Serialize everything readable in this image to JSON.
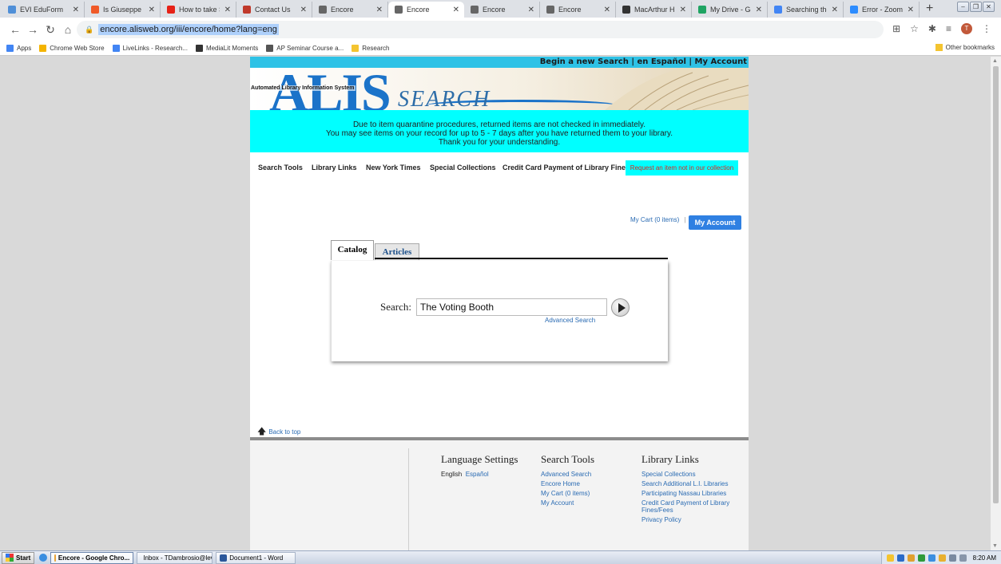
{
  "browser": {
    "tabs": [
      {
        "label": "EVI EduForm",
        "color": "#4f8fd8",
        "active": false
      },
      {
        "label": "Is Giuseppe Cor",
        "color": "#f05a28",
        "active": false
      },
      {
        "label": "How to take Scr",
        "color": "#e62117",
        "active": false
      },
      {
        "label": "Contact Us",
        "color": "#c0392b",
        "active": false
      },
      {
        "label": "Encore",
        "color": "#666666",
        "active": false
      },
      {
        "label": "Encore",
        "color": "#666666",
        "active": true
      },
      {
        "label": "Encore",
        "color": "#666666",
        "active": false
      },
      {
        "label": "Encore",
        "color": "#666666",
        "active": false
      },
      {
        "label": "MacArthur High",
        "color": "#333333",
        "active": false
      },
      {
        "label": "My Drive - Goo",
        "color": "#1fa463",
        "active": false
      },
      {
        "label": "Searching the L",
        "color": "#4285f4",
        "active": false
      },
      {
        "label": "Error - Zoom",
        "color": "#2d8cff",
        "active": false
      }
    ],
    "url": "encore.alisweb.org/iii/encore/home?lang=eng",
    "profile_initial": "T",
    "bookmarks": [
      {
        "label": "Apps",
        "color": "#4285f4"
      },
      {
        "label": "Chrome Web Store",
        "color": "#f4b400"
      },
      {
        "label": "LiveLinks - Research...",
        "color": "#4285f4"
      },
      {
        "label": "MediaLit Moments",
        "color": "#333333"
      },
      {
        "label": "AP Seminar Course a...",
        "color": "#555555"
      },
      {
        "label": "Research",
        "color": "#f4c430"
      }
    ],
    "other_bookmarks": "Other bookmarks"
  },
  "site": {
    "top_links": "Begin a new Search | en Español | My Account",
    "logo_text": "ALIS",
    "logo_subtitle": "Automated Library Information System",
    "logo_search": "SEARCH",
    "notice": [
      "Due to item quarantine procedures, returned items are not checked in immediately.",
      "You may see items on your record for up to 5 - 7 days after you have returned them to your library.",
      "Thank you for your understanding."
    ],
    "nav": {
      "search_tools": "Search Tools",
      "library_links": "Library Links",
      "nyt": "New York Times",
      "special": "Special Collections",
      "credit": "Credit Card Payment of Library Fines",
      "request": "Request an item not in our collection"
    },
    "cart": "My Cart (0 items)",
    "cart_sep": "|",
    "my_account": "My Account",
    "tabs": {
      "catalog": "Catalog",
      "articles": "Articles"
    },
    "search_label": "Search:",
    "search_value": "The Voting Booth",
    "advanced_search": "Advanced Search",
    "back_to_top": "Back to top",
    "footer": {
      "language": {
        "title": "Language Settings",
        "items": [
          "English",
          "Español"
        ]
      },
      "search_tools": {
        "title": "Search Tools",
        "items": [
          "Advanced Search",
          "Encore Home",
          "My Cart (0 items)",
          "My Account"
        ]
      },
      "library_links": {
        "title": "Library Links",
        "items": [
          "Special Collections",
          "Search Additional L.I. Libraries",
          "Participating Nassau Libraries",
          "Credit Card Payment of Library Fines/Fees",
          "Privacy Policy"
        ]
      }
    }
  },
  "taskbar": {
    "start": "Start",
    "tasks": [
      {
        "label": "Encore - Google Chro...",
        "color": "#e8a33a",
        "active": true
      },
      {
        "label": "Inbox - TDambrosio@levi...",
        "color": "#2a6ac8",
        "active": false
      },
      {
        "label": "Document1 - Word",
        "color": "#2b579a",
        "active": false
      }
    ],
    "clock": "8:20 AM"
  },
  "colors": {
    "accent": "#2f80e2",
    "notice_bg": "#00ffff",
    "topbar": "#2ec2e6",
    "request_text": "#e0241c"
  }
}
